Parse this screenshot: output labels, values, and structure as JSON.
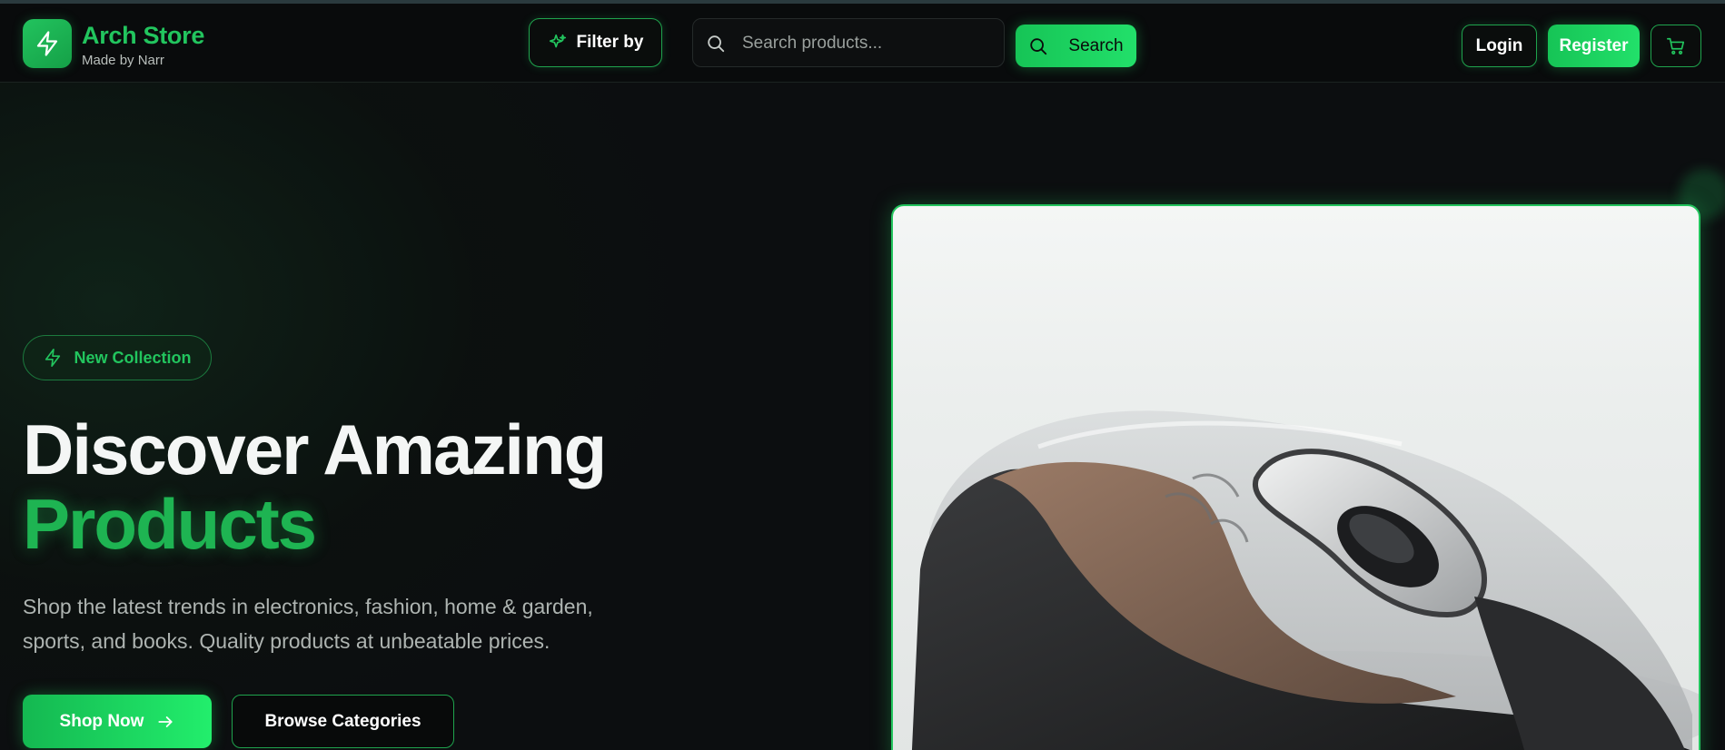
{
  "header": {
    "brand_name": "Arch Store",
    "brand_sub": "Made by Narr",
    "logo_icon": "lightning-icon",
    "filter_label": "Filter by",
    "filter_icon": "sparkles-icon",
    "search_placeholder": "Search products...",
    "search_icon": "search-icon",
    "search_button_label": "Search",
    "login_label": "Login",
    "register_label": "Register",
    "cart_icon": "cart-icon"
  },
  "hero": {
    "badge_label": "New Collection",
    "badge_icon": "lightning-icon",
    "title_line1": "Discover Amazing",
    "title_line2": "Products",
    "description": "Shop the latest trends in electronics, fashion, home & garden, sports, and books. Quality products at unbeatable prices.",
    "shop_button_label": "Shop Now",
    "shop_button_icon": "arrow-right-icon",
    "browse_button_label": "Browse Categories",
    "product_image": "computer-mouse-image"
  },
  "colors": {
    "accent": "#22c55e",
    "accent_bright": "#22e06a",
    "background": "#0c0e10",
    "header_bg": "#090b0c",
    "text_muted": "#aeb4b1"
  }
}
